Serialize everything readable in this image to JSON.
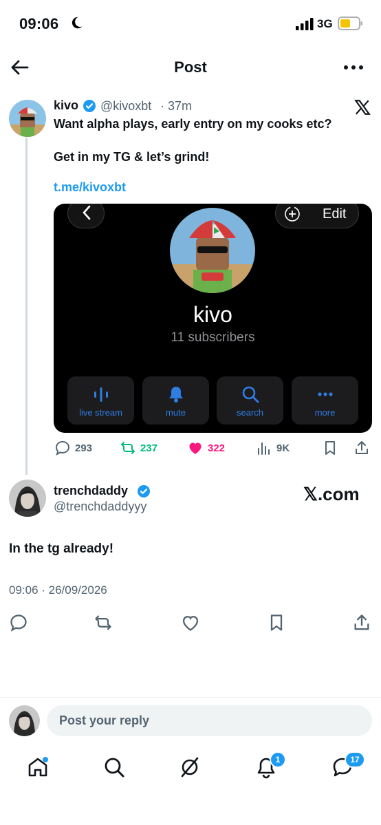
{
  "status_bar": {
    "time": "09:06",
    "network": "3G",
    "icons": [
      "moon-icon",
      "signal-icon",
      "battery-icon"
    ]
  },
  "header": {
    "title": "Post",
    "back_icon": "arrow-left-icon",
    "more_icon": "more-icon"
  },
  "tweet": {
    "name": "kivo",
    "handle": "@kivoxbt",
    "time": "· 37m",
    "text_line1": "Want alpha plays, early entry on my cooks etc?",
    "text_line2": "Get in my TG & let’s grind!",
    "link": "t.me/kivoxbt",
    "media": {
      "edit_label": "Edit",
      "channel_name": "kivo",
      "subscribers": "11 subscribers",
      "buttons": [
        {
          "label": "live stream",
          "icon": "live-stream-icon"
        },
        {
          "label": "mute",
          "icon": "bell-icon"
        },
        {
          "label": "search",
          "icon": "search-icon"
        },
        {
          "label": "more",
          "icon": "more-icon"
        }
      ]
    },
    "stats": {
      "replies": "293",
      "reposts": "237",
      "likes": "322",
      "views": "9K"
    }
  },
  "reply": {
    "name": "trenchdaddy",
    "handle": "@trenchdaddyyy",
    "watermark": "𝕏.com",
    "text": "In the tg already!",
    "meta": "09:06 · 26/09/2026"
  },
  "compose": {
    "placeholder": "Post your reply"
  },
  "bottom_nav": {
    "items": [
      "home-icon",
      "search-icon",
      "grok-icon",
      "notifications-icon",
      "messages-icon"
    ],
    "notifications_badge": "1",
    "messages_badge": "17"
  },
  "colors": {
    "accent": "#1d9bf0",
    "repost": "#00ba7c",
    "like": "#f91880",
    "text": "#0f1419",
    "muted": "#536471"
  }
}
